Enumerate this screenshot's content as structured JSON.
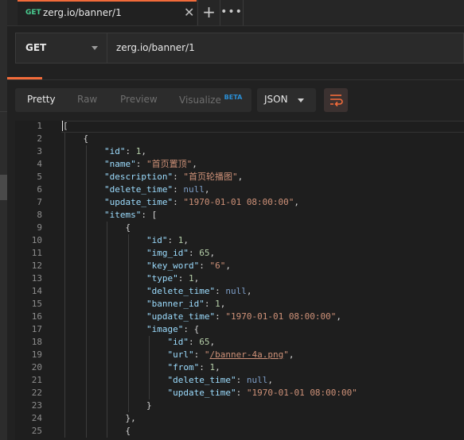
{
  "tab": {
    "method": "GET",
    "title": "zerg.io/banner/1",
    "close_glyph": "✕",
    "new_tab_glyph": "+",
    "more_glyph": "•••"
  },
  "request": {
    "method": "GET",
    "url": "zerg.io/banner/1"
  },
  "toolbar": {
    "view_modes": [
      "Pretty",
      "Raw",
      "Preview",
      "Visualize"
    ],
    "active_view": "Pretty",
    "beta_badge": "BETA",
    "format": "JSON",
    "wrap_icon": "wrap-lines-icon"
  },
  "colors": {
    "accent": "#f26b3a",
    "get_method": "#49cc90",
    "beta": "#2a8fd6"
  },
  "code_lines": [
    {
      "n": "1",
      "indent": 0,
      "parts": [
        [
          "p",
          "["
        ]
      ]
    },
    {
      "n": "2",
      "indent": 1,
      "parts": [
        [
          "p",
          "{"
        ]
      ]
    },
    {
      "n": "3",
      "indent": 2,
      "parts": [
        [
          "k",
          "\"id\""
        ],
        [
          "p",
          ": "
        ],
        [
          "n",
          "1"
        ],
        [
          "p",
          ","
        ]
      ]
    },
    {
      "n": "4",
      "indent": 2,
      "parts": [
        [
          "k",
          "\"name\""
        ],
        [
          "p",
          ": "
        ],
        [
          "s",
          "\"首页置顶\""
        ],
        [
          "p",
          ","
        ]
      ]
    },
    {
      "n": "5",
      "indent": 2,
      "parts": [
        [
          "k",
          "\"description\""
        ],
        [
          "p",
          ": "
        ],
        [
          "s",
          "\"首页轮播图\""
        ],
        [
          "p",
          ","
        ]
      ]
    },
    {
      "n": "6",
      "indent": 2,
      "parts": [
        [
          "k",
          "\"delete_time\""
        ],
        [
          "p",
          ": "
        ],
        [
          "nl",
          "null"
        ],
        [
          "p",
          ","
        ]
      ]
    },
    {
      "n": "7",
      "indent": 2,
      "parts": [
        [
          "k",
          "\"update_time\""
        ],
        [
          "p",
          ": "
        ],
        [
          "s",
          "\"1970-01-01 08:00:00\""
        ],
        [
          "p",
          ","
        ]
      ]
    },
    {
      "n": "8",
      "indent": 2,
      "parts": [
        [
          "k",
          "\"items\""
        ],
        [
          "p",
          ": ["
        ]
      ]
    },
    {
      "n": "9",
      "indent": 3,
      "parts": [
        [
          "p",
          "{"
        ]
      ]
    },
    {
      "n": "10",
      "indent": 4,
      "parts": [
        [
          "k",
          "\"id\""
        ],
        [
          "p",
          ": "
        ],
        [
          "n",
          "1"
        ],
        [
          "p",
          ","
        ]
      ]
    },
    {
      "n": "11",
      "indent": 4,
      "parts": [
        [
          "k",
          "\"img_id\""
        ],
        [
          "p",
          ": "
        ],
        [
          "n",
          "65"
        ],
        [
          "p",
          ","
        ]
      ]
    },
    {
      "n": "12",
      "indent": 4,
      "parts": [
        [
          "k",
          "\"key_word\""
        ],
        [
          "p",
          ": "
        ],
        [
          "s",
          "\"6\""
        ],
        [
          "p",
          ","
        ]
      ]
    },
    {
      "n": "13",
      "indent": 4,
      "parts": [
        [
          "k",
          "\"type\""
        ],
        [
          "p",
          ": "
        ],
        [
          "n",
          "1"
        ],
        [
          "p",
          ","
        ]
      ]
    },
    {
      "n": "14",
      "indent": 4,
      "parts": [
        [
          "k",
          "\"delete_time\""
        ],
        [
          "p",
          ": "
        ],
        [
          "nl",
          "null"
        ],
        [
          "p",
          ","
        ]
      ]
    },
    {
      "n": "15",
      "indent": 4,
      "parts": [
        [
          "k",
          "\"banner_id\""
        ],
        [
          "p",
          ": "
        ],
        [
          "n",
          "1"
        ],
        [
          "p",
          ","
        ]
      ]
    },
    {
      "n": "16",
      "indent": 4,
      "parts": [
        [
          "k",
          "\"update_time\""
        ],
        [
          "p",
          ": "
        ],
        [
          "s",
          "\"1970-01-01 08:00:00\""
        ],
        [
          "p",
          ","
        ]
      ]
    },
    {
      "n": "17",
      "indent": 4,
      "parts": [
        [
          "k",
          "\"image\""
        ],
        [
          "p",
          ": {"
        ]
      ]
    },
    {
      "n": "18",
      "indent": 5,
      "parts": [
        [
          "k",
          "\"id\""
        ],
        [
          "p",
          ": "
        ],
        [
          "n",
          "65"
        ],
        [
          "p",
          ","
        ]
      ]
    },
    {
      "n": "19",
      "indent": 5,
      "parts": [
        [
          "k",
          "\"url\""
        ],
        [
          "p",
          ": "
        ],
        [
          "s",
          "\""
        ],
        [
          "u",
          "/banner-4a.png"
        ],
        [
          "s",
          "\""
        ],
        [
          "p",
          ","
        ]
      ]
    },
    {
      "n": "20",
      "indent": 5,
      "parts": [
        [
          "k",
          "\"from\""
        ],
        [
          "p",
          ": "
        ],
        [
          "n",
          "1"
        ],
        [
          "p",
          ","
        ]
      ]
    },
    {
      "n": "21",
      "indent": 5,
      "parts": [
        [
          "k",
          "\"delete_time\""
        ],
        [
          "p",
          ": "
        ],
        [
          "nl",
          "null"
        ],
        [
          "p",
          ","
        ]
      ]
    },
    {
      "n": "22",
      "indent": 5,
      "parts": [
        [
          "k",
          "\"update_time\""
        ],
        [
          "p",
          ": "
        ],
        [
          "s",
          "\"1970-01-01 08:00:00\""
        ]
      ]
    },
    {
      "n": "23",
      "indent": 4,
      "parts": [
        [
          "p",
          "}"
        ]
      ]
    },
    {
      "n": "24",
      "indent": 3,
      "parts": [
        [
          "p",
          "},"
        ]
      ]
    },
    {
      "n": "25",
      "indent": 3,
      "parts": [
        [
          "p",
          "{"
        ]
      ]
    }
  ]
}
